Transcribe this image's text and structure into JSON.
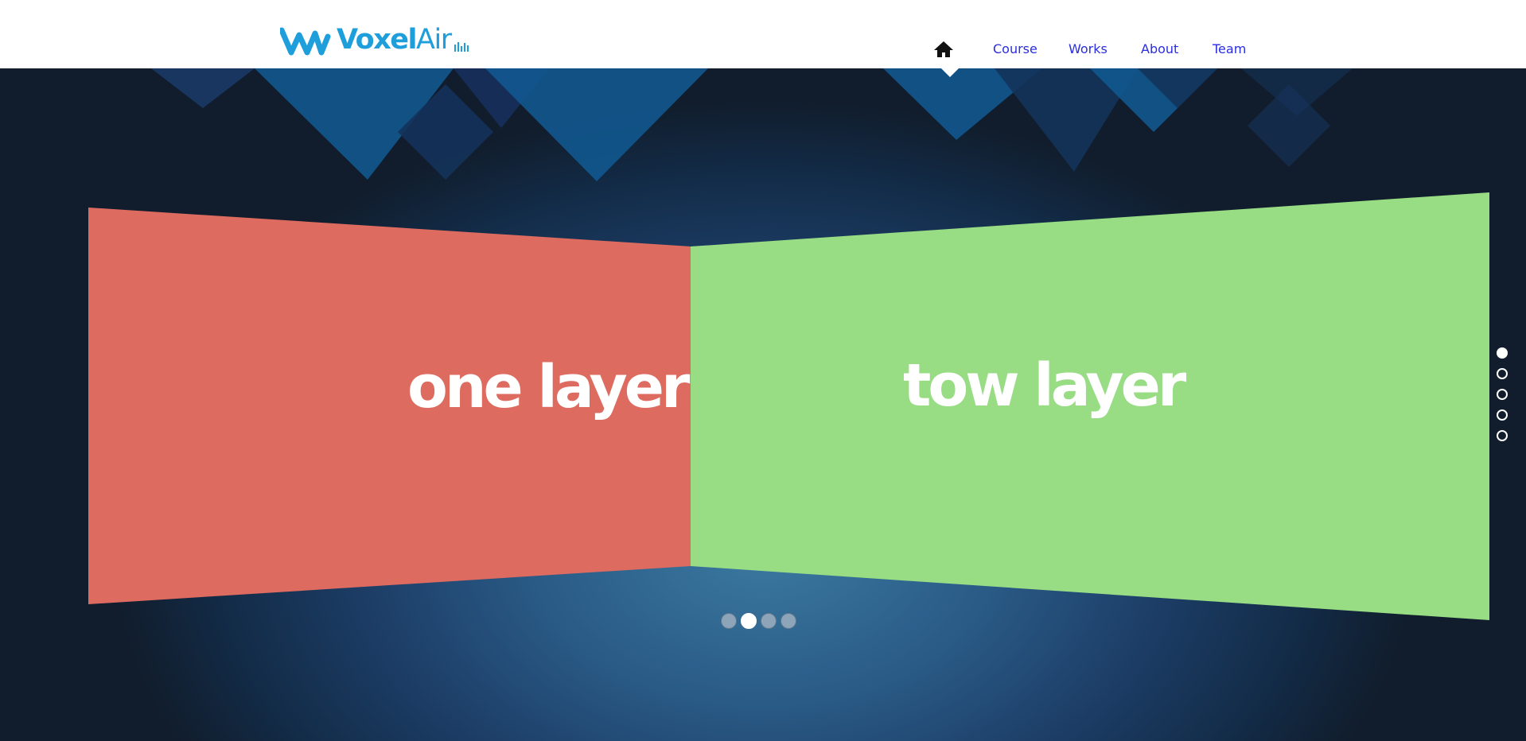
{
  "brand": {
    "name_bold": "Voxel",
    "name_light": "Air",
    "color": "#1e9fdc"
  },
  "nav": {
    "home_icon": "home-icon",
    "items": [
      {
        "label": "Course"
      },
      {
        "label": "Works"
      },
      {
        "label": "About"
      },
      {
        "label": "Team"
      }
    ],
    "link_color": "#2a2de0"
  },
  "slides": {
    "left_panel": {
      "label": "one layer",
      "color": "#dd6b60"
    },
    "right_panel": {
      "label": "tow layer",
      "color": "#98dc84"
    }
  },
  "carousel": {
    "count": 4,
    "active_index": 1
  },
  "section_nav": {
    "count": 5,
    "active_index": 0
  },
  "colors": {
    "header_bg": "#ffffff",
    "hero_dark": "#111d2c",
    "hero_light": "#3b7aa1"
  }
}
